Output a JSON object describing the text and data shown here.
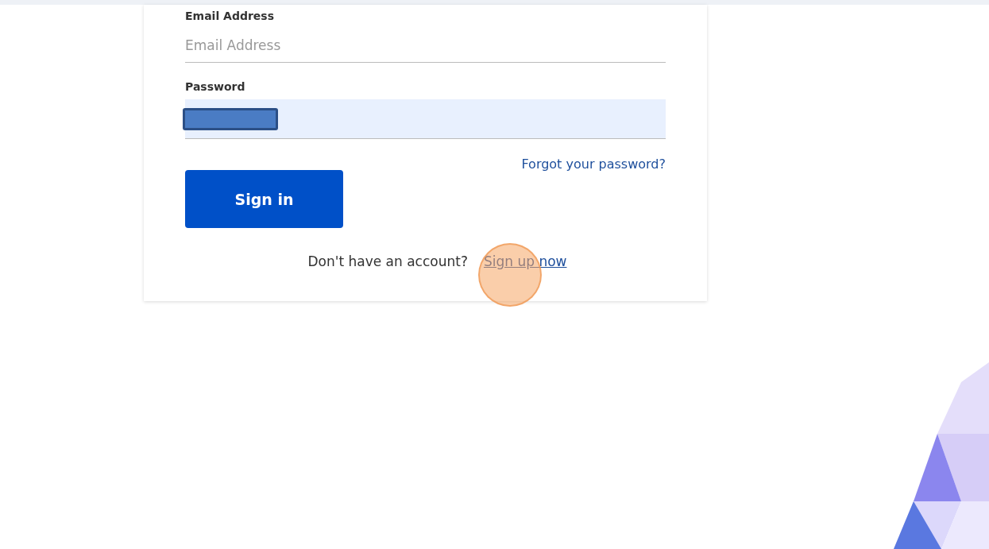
{
  "email": {
    "label": "Email Address",
    "placeholder": "Email Address"
  },
  "password": {
    "label": "Password"
  },
  "forgot_link": "Forgot your password?",
  "sign_in_button": "Sign in",
  "signup_prompt": {
    "text": "Don't have an account?",
    "link": "Sign up now"
  }
}
